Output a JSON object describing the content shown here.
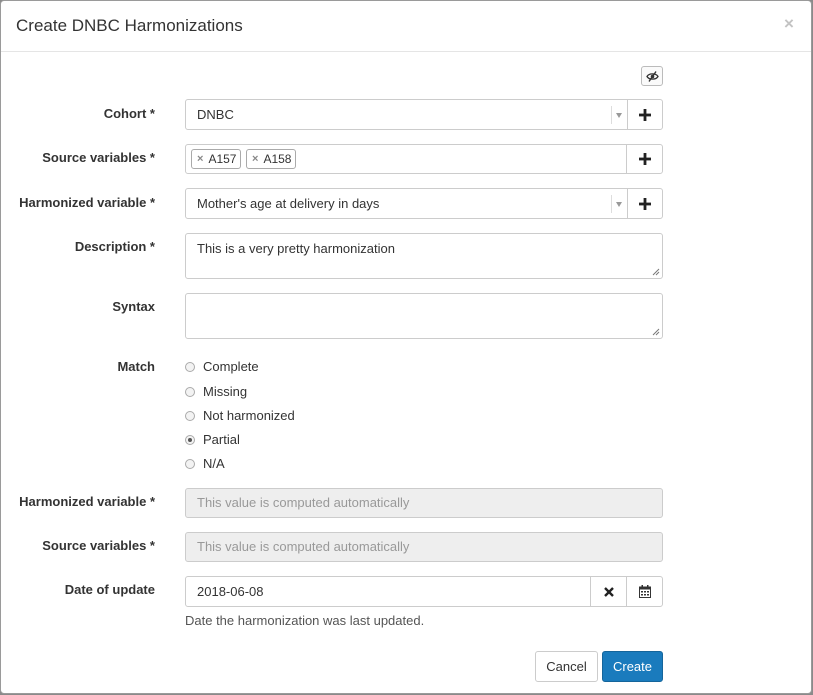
{
  "modal": {
    "title": "Create DNBC Harmonizations",
    "close_glyph": "×"
  },
  "form": {
    "cohort": {
      "label": "Cohort *",
      "value": "DNBC"
    },
    "source_variables": {
      "label": "Source variables *",
      "tags": [
        "A157",
        "A158"
      ],
      "remove_glyph": "×"
    },
    "harmonized_variable": {
      "label": "Harmonized variable *",
      "value": "Mother's age at delivery in days"
    },
    "description": {
      "label": "Description *",
      "value": "This is a very pretty harmonization"
    },
    "syntax": {
      "label": "Syntax",
      "value": ""
    },
    "match": {
      "label": "Match",
      "options": [
        "Complete",
        "Missing",
        "Not harmonized",
        "Partial",
        "N/A"
      ],
      "selected": "Partial"
    },
    "harmonized_variable_computed": {
      "label": "Harmonized variable *",
      "placeholder": "This value is computed automatically"
    },
    "source_variables_computed": {
      "label": "Source variables *",
      "placeholder": "This value is computed automatically"
    },
    "date_of_update": {
      "label": "Date of update",
      "value": "2018-06-08",
      "help": "Date the harmonization was last updated."
    }
  },
  "footer": {
    "cancel_label": "Cancel",
    "create_label": "Create"
  },
  "icons": {
    "visibility_toggle": "eye-slash-icon",
    "add": "plus-icon",
    "clear": "times-icon",
    "calendar": "calendar-icon",
    "dropdown": "caret-down-icon"
  },
  "colors": {
    "primary": "#1a7bbd",
    "border": "#cccccc",
    "disabled_bg": "#eeeeee"
  }
}
